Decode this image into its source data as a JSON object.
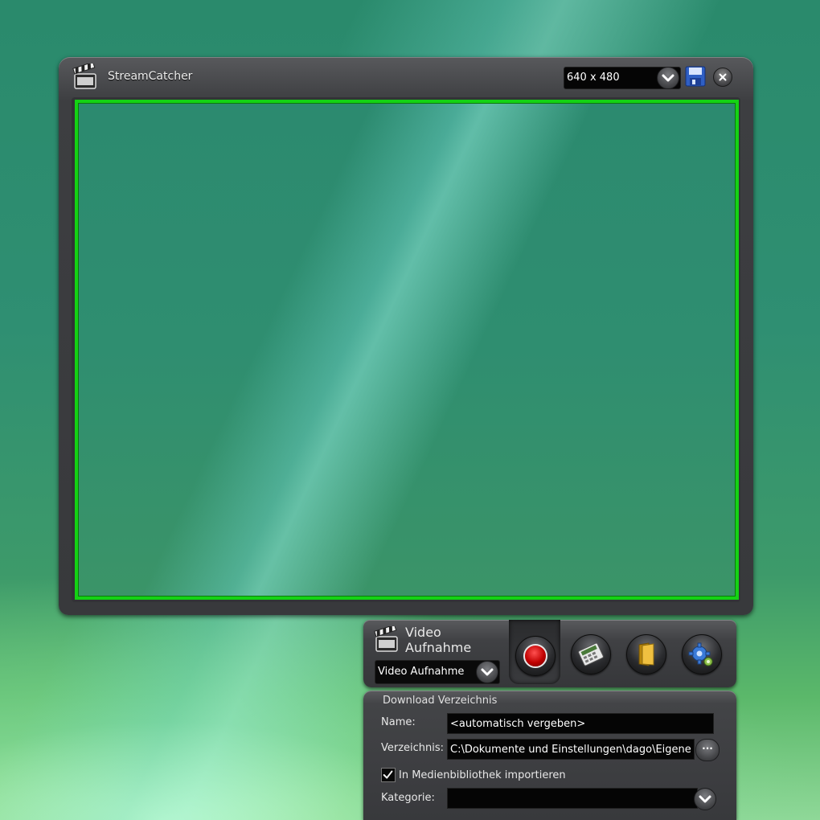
{
  "window": {
    "title": "StreamCatcher",
    "resolution": "640 x 480"
  },
  "controls": {
    "mode_title": "Video Aufnahme",
    "mode_select_value": "Video Aufnahme"
  },
  "download": {
    "header": "Download Verzeichnis",
    "name_label": "Name:",
    "name_value": "<automatisch vergeben>",
    "dir_label": "Verzeichnis:",
    "dir_value": "C:\\Dokumente und Einstellungen\\dago\\Eigene ...",
    "browse_label": "···",
    "import_label": "In Medienbibliothek importieren",
    "import_checked": true,
    "category_label": "Kategorie:",
    "category_value": ""
  },
  "colors": {
    "preview_border": "#14d214",
    "record_red": "#c00000",
    "panel_dark": "#38393c"
  },
  "icons": [
    "clapperboard-icon",
    "save-icon",
    "close-icon",
    "record-icon",
    "calculator-icon",
    "folder-icon",
    "gear-icon",
    "chevron-down-icon",
    "checkmark-icon"
  ]
}
